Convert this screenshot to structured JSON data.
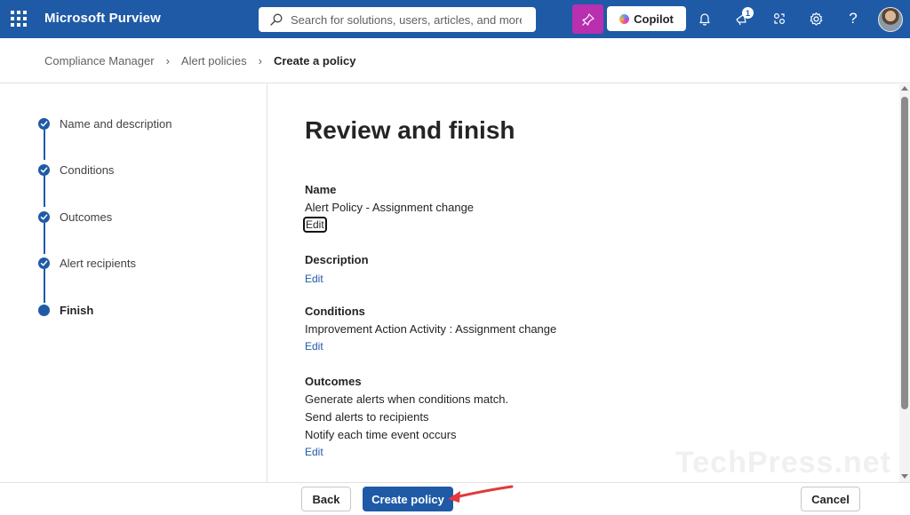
{
  "app": {
    "title": "Microsoft Purview",
    "search_placeholder": "Search for solutions, users, articles, and more",
    "copilot_label": "Copilot",
    "notification_count": "1",
    "icons": [
      "waffle-icon",
      "search-icon",
      "pin-icon",
      "bell-icon",
      "megaphone-icon",
      "share-icon",
      "gear-icon",
      "help-icon",
      "avatar"
    ]
  },
  "breadcrumb": {
    "items": [
      "Compliance Manager",
      "Alert policies"
    ],
    "current": "Create a policy"
  },
  "steps": [
    {
      "label": "Name and description",
      "state": "completed"
    },
    {
      "label": "Conditions",
      "state": "completed"
    },
    {
      "label": "Outcomes",
      "state": "completed"
    },
    {
      "label": "Alert recipients",
      "state": "completed"
    },
    {
      "label": "Finish",
      "state": "current"
    }
  ],
  "main": {
    "title": "Review and finish",
    "sections": [
      {
        "heading": "Name",
        "values": [
          "Alert Policy - Assignment change"
        ],
        "edit_label": "Edit"
      },
      {
        "heading": "Description",
        "values": [],
        "edit_label": "Edit"
      },
      {
        "heading": "Conditions",
        "values": [
          "Improvement Action Activity : Assignment change"
        ],
        "edit_label": "Edit"
      },
      {
        "heading": "Outcomes",
        "values": [
          "Generate alerts when conditions match.",
          "Send alerts to recipients",
          "Notify each time event occurs"
        ],
        "edit_label": "Edit"
      }
    ]
  },
  "footer": {
    "back_label": "Back",
    "create_label": "Create policy",
    "cancel_label": "Cancel"
  },
  "watermark": "TechPress.net",
  "colors": {
    "brand": "#1f5aa6",
    "copilot_pin": "#b82fb0",
    "annotation_arrow": "#e03a3e"
  }
}
